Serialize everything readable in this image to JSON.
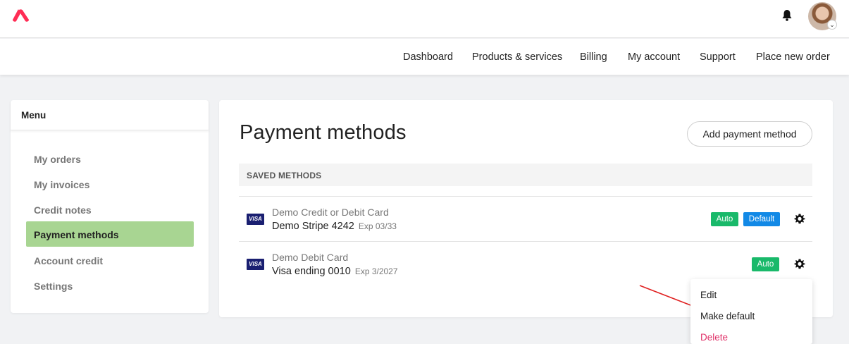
{
  "brand": {
    "logo_icon": "brand-logo-icon",
    "accent": "#ff2d55"
  },
  "header": {
    "notifications_icon": "bell-icon",
    "avatar_caret": "⌄"
  },
  "nav": {
    "items": [
      {
        "label": "Dashboard"
      },
      {
        "label": "Products & services"
      },
      {
        "label": "Billing"
      },
      {
        "label": "My account"
      },
      {
        "label": "Support"
      },
      {
        "label": "Place new order"
      }
    ]
  },
  "sidebar": {
    "title": "Menu",
    "items": [
      {
        "label": "My orders"
      },
      {
        "label": "My invoices"
      },
      {
        "label": "Credit notes"
      },
      {
        "label": "Payment methods",
        "active": true
      },
      {
        "label": "Account credit"
      },
      {
        "label": "Settings"
      }
    ],
    "active_color": "#a8d592"
  },
  "main": {
    "title": "Payment methods",
    "add_button": "Add payment method",
    "section_title": "SAVED METHODS",
    "methods": [
      {
        "brand": "VISA",
        "name": "Demo Credit or Debit Card",
        "label": "Demo Stripe 4242",
        "exp": "Exp 03/33",
        "badges": [
          "Auto",
          "Default"
        ]
      },
      {
        "brand": "VISA",
        "name": "Demo Debit Card",
        "label": "Visa ending 0010",
        "exp": "Exp 3/2027",
        "badges": [
          "Auto"
        ]
      }
    ],
    "badge_colors": {
      "auto": "#19b96a",
      "default": "#1289e6"
    }
  },
  "dropdown": {
    "items": [
      {
        "label": "Edit"
      },
      {
        "label": "Make default"
      },
      {
        "label": "Delete",
        "danger": true
      }
    ]
  }
}
